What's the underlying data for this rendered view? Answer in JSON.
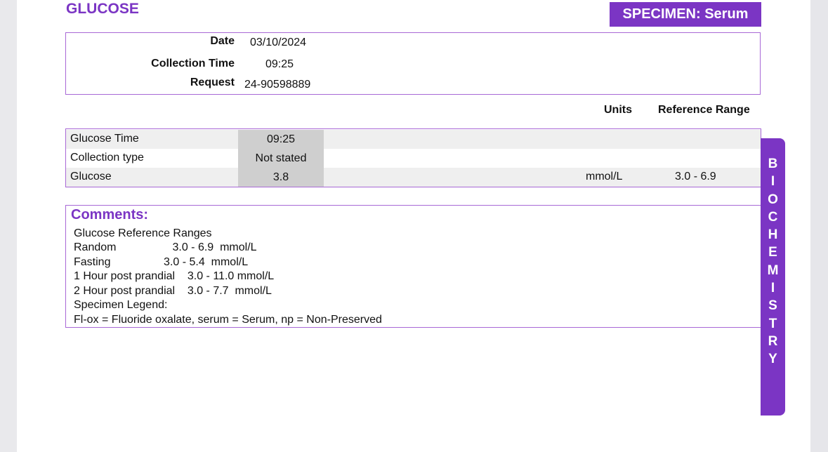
{
  "header": {
    "title": "GLUCOSE",
    "specimen": "SPECIMEN: Serum"
  },
  "info": {
    "date_label": "Date",
    "date_value": "03/10/2024",
    "time_label": "Collection Time",
    "time_value": "09:25",
    "request_label": "Request",
    "request_value": "24-90598889"
  },
  "columns": {
    "units": "Units",
    "range": "Reference Range"
  },
  "results": [
    {
      "name": "Glucose Time",
      "value": "09:25",
      "units": "",
      "range": ""
    },
    {
      "name": "Collection type",
      "value": "Not stated",
      "units": "",
      "range": ""
    },
    {
      "name": "Glucose",
      "value": "3.8",
      "units": "mmol/L",
      "range": "3.0 - 6.9"
    }
  ],
  "comments": {
    "title": "Comments:",
    "lines": [
      "Glucose Reference Ranges",
      "Random                  3.0 - 6.9  mmol/L",
      "Fasting                 3.0 - 5.4  mmol/L",
      "1 Hour post prandial    3.0 - 11.0 mmol/L",
      "2 Hour post prandial    3.0 - 7.7  mmol/L",
      "Specimen Legend:",
      "Fl-ox = Fluoride oxalate, serum = Serum, np = Non-Preserved"
    ]
  },
  "side_tab": {
    "letters": [
      "B",
      "I",
      "O",
      "C",
      "H",
      "E",
      "M",
      "I",
      "S",
      "T",
      "R",
      "Y"
    ]
  },
  "colors": {
    "accent": "#7b35c4",
    "border": "#a868d6"
  }
}
